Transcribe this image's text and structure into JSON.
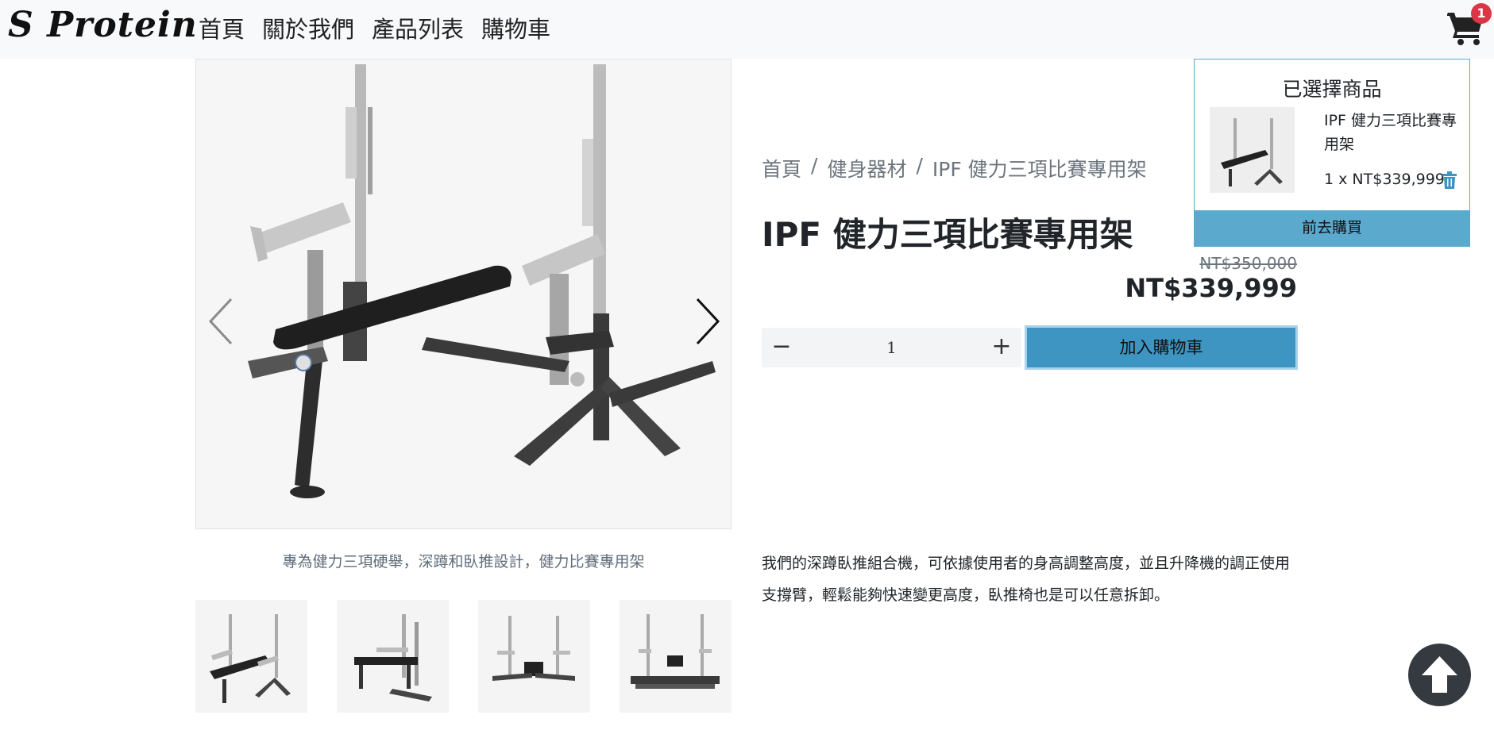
{
  "navbar": {
    "brand": "S Protein",
    "links": [
      "首頁",
      "關於我們",
      "產品列表",
      "購物車"
    ],
    "cart_count": "1"
  },
  "gallery": {
    "caption": "專為健力三項硬舉，深蹲和臥推設計，健力比賽專用架",
    "main_image": "squat-bench-rack-image",
    "thumbnails": [
      "rack-thumbnail-1",
      "rack-thumbnail-2",
      "rack-thumbnail-3",
      "rack-thumbnail-4"
    ]
  },
  "product": {
    "breadcrumb": [
      "首頁",
      "健身器材",
      "IPF 健力三項比賽專用架"
    ],
    "breadcrumb_sep": "/",
    "title": "IPF 健力三項比賽專用架",
    "price_old": "NT$350,000",
    "price_new": "NT$339,999",
    "qty_minus": "−",
    "qty_plus": "+",
    "qty_value": "1",
    "add_to_cart": "加入購物車",
    "description": "我們的深蹲臥推組合機，可依據使用者的身高調整高度，並且升降機的調正使用支撐臂，輕鬆能夠快速變更高度，臥推椅也是可以任意拆卸。"
  },
  "cart_panel": {
    "heading": "已選擇商品",
    "item_name": "IPF 健力三項比賽專用架",
    "item_price": "1 x NT$339,999",
    "checkout": "前去購買"
  },
  "colors": {
    "accent": "#3e95c2",
    "panel_button": "#5ca9ce",
    "badge": "#dc3545"
  }
}
